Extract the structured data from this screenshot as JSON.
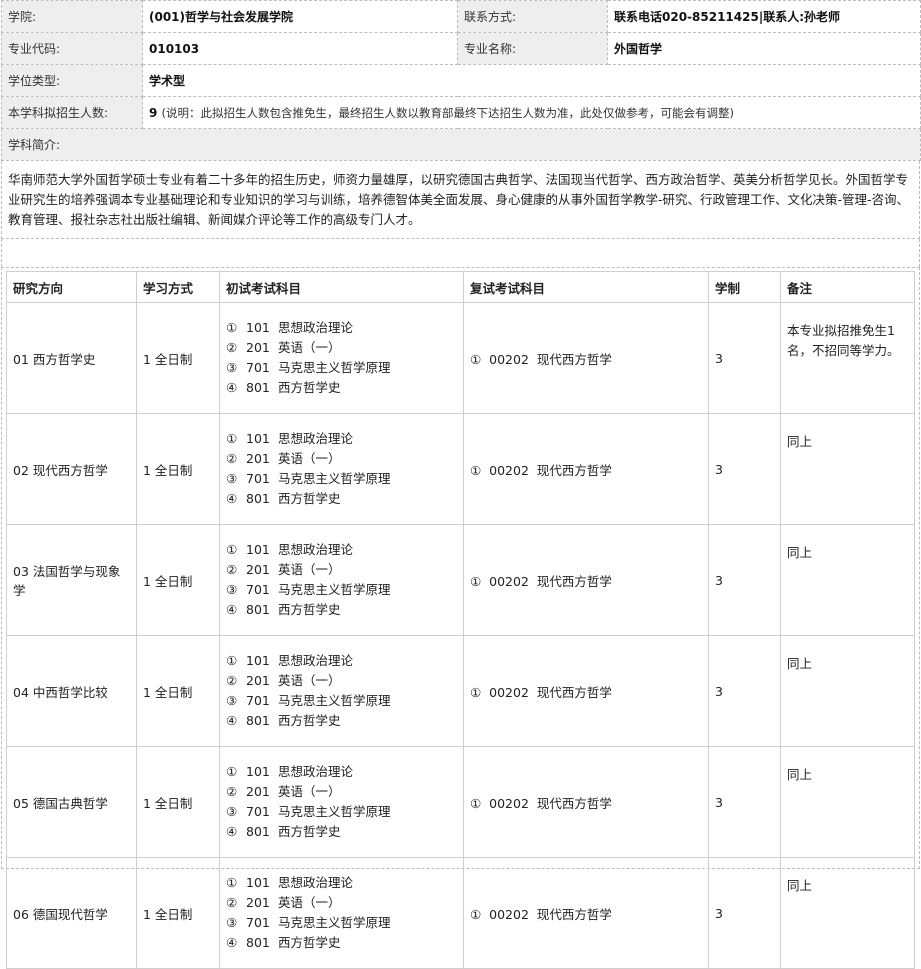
{
  "info": {
    "college_label": "学院:",
    "college_value": "(001)哲学与社会发展学院",
    "contact_label": "联系方式:",
    "contact_value": "联系电话020-85211425|联系人:孙老师",
    "major_code_label": "专业代码:",
    "major_code_value": "010103",
    "major_name_label": "专业名称:",
    "major_name_value": "外国哲学",
    "degree_type_label": "学位类型:",
    "degree_type_value": "学术型",
    "enrollment_label": "本学科拟招生人数:",
    "enrollment_value": "9",
    "enrollment_note": "(说明：此拟招生人数包含推免生，最终招生人数以教育部最终下达招生人数为准，此处仅做参考，可能会有调整)",
    "intro_label": "学科简介:",
    "intro_text": "华南师范大学外国哲学硕士专业有着二十多年的招生历史，师资力量雄厚，以研究德国古典哲学、法国现当代哲学、西方政治哲学、英美分析哲学见长。外国哲学专业研究生的培养强调本专业基础理论和专业知识的学习与训练，培养德智体美全面发展、身心健康的从事外国哲学教学-研究、行政管理工作、文化决策-管理-咨询、教育管理、报社杂志社出版社编辑、新闻媒介评论等工作的高级专门人才。"
  },
  "table": {
    "headers": [
      "研究方向",
      "学习方式",
      "初试考试科目",
      "复试考试科目",
      "学制",
      "备注"
    ],
    "rows": [
      {
        "direction": "01 西方哲学史",
        "mode": "1 全日制",
        "initial": [
          {
            "mark": "①",
            "code": "101",
            "name": "思想政治理论"
          },
          {
            "mark": "②",
            "code": "201",
            "name": "英语（一）"
          },
          {
            "mark": "③",
            "code": "701",
            "name": "马克思主义哲学原理"
          },
          {
            "mark": "④",
            "code": "801",
            "name": "西方哲学史"
          }
        ],
        "retest": "①  00202  现代西方哲学",
        "years": "3",
        "remark": "本专业拟招推免生1名，不招同等学力。"
      },
      {
        "direction": "02 现代西方哲学",
        "mode": "1 全日制",
        "initial": [
          {
            "mark": "①",
            "code": "101",
            "name": "思想政治理论"
          },
          {
            "mark": "②",
            "code": "201",
            "name": "英语（一）"
          },
          {
            "mark": "③",
            "code": "701",
            "name": "马克思主义哲学原理"
          },
          {
            "mark": "④",
            "code": "801",
            "name": "西方哲学史"
          }
        ],
        "retest": "①  00202  现代西方哲学",
        "years": "3",
        "remark": "同上"
      },
      {
        "direction": "03 法国哲学与现象学",
        "mode": "1 全日制",
        "initial": [
          {
            "mark": "①",
            "code": "101",
            "name": "思想政治理论"
          },
          {
            "mark": "②",
            "code": "201",
            "name": "英语（一）"
          },
          {
            "mark": "③",
            "code": "701",
            "name": "马克思主义哲学原理"
          },
          {
            "mark": "④",
            "code": "801",
            "name": "西方哲学史"
          }
        ],
        "retest": "①  00202  现代西方哲学",
        "years": "3",
        "remark": "同上"
      },
      {
        "direction": "04 中西哲学比较",
        "mode": "1 全日制",
        "initial": [
          {
            "mark": "①",
            "code": "101",
            "name": "思想政治理论"
          },
          {
            "mark": "②",
            "code": "201",
            "name": "英语（一）"
          },
          {
            "mark": "③",
            "code": "701",
            "name": "马克思主义哲学原理"
          },
          {
            "mark": "④",
            "code": "801",
            "name": "西方哲学史"
          }
        ],
        "retest": "①  00202  现代西方哲学",
        "years": "3",
        "remark": "同上"
      },
      {
        "direction": "05 德国古典哲学",
        "mode": "1 全日制",
        "initial": [
          {
            "mark": "①",
            "code": "101",
            "name": "思想政治理论"
          },
          {
            "mark": "②",
            "code": "201",
            "name": "英语（一）"
          },
          {
            "mark": "③",
            "code": "701",
            "name": "马克思主义哲学原理"
          },
          {
            "mark": "④",
            "code": "801",
            "name": "西方哲学史"
          }
        ],
        "retest": "①  00202  现代西方哲学",
        "years": "3",
        "remark": "同上"
      },
      {
        "direction": "06 德国现代哲学",
        "mode": "1 全日制",
        "initial": [
          {
            "mark": "①",
            "code": "101",
            "name": "思想政治理论"
          },
          {
            "mark": "②",
            "code": "201",
            "name": "英语（一）"
          },
          {
            "mark": "③",
            "code": "701",
            "name": "马克思主义哲学原理"
          },
          {
            "mark": "④",
            "code": "801",
            "name": "西方哲学史"
          }
        ],
        "retest": "①  00202  现代西方哲学",
        "years": "3",
        "remark": "同上"
      }
    ]
  }
}
